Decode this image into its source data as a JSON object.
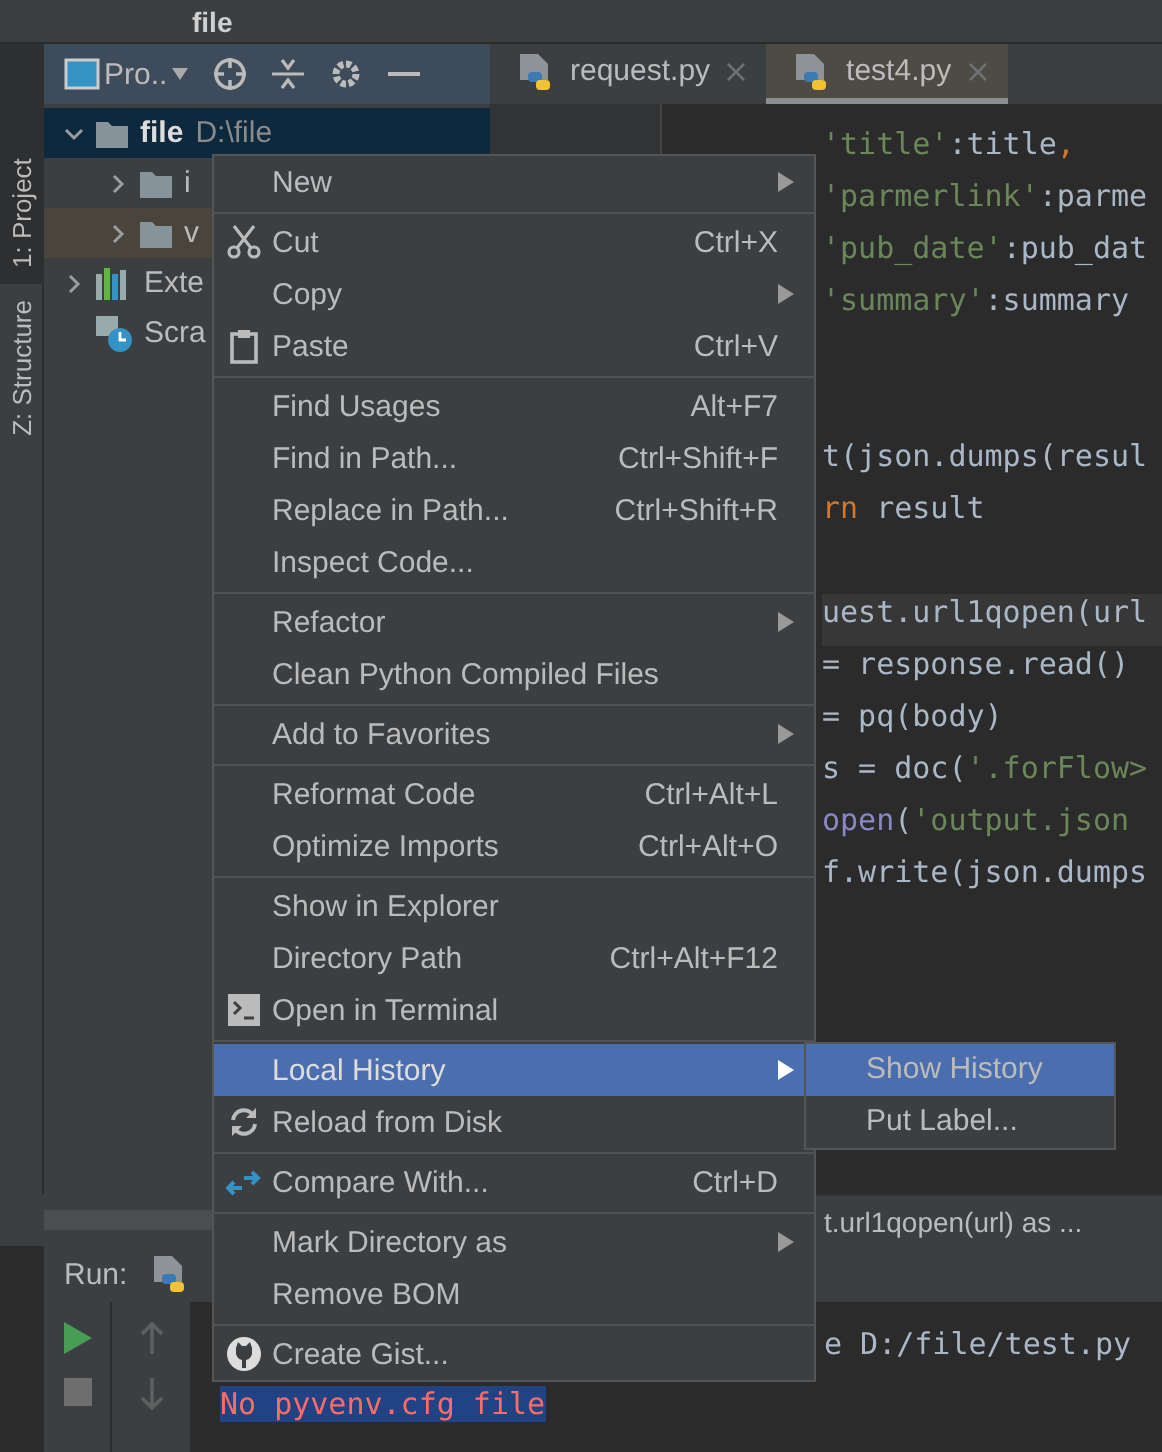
{
  "window": {
    "title": "file"
  },
  "tool_strip": [
    {
      "label": "1: Project",
      "selected": true
    },
    {
      "label": "Z: Structure",
      "selected": false
    }
  ],
  "project_panel": {
    "view": "Pro.."
  },
  "tree": [
    {
      "name": "file",
      "path": "D:\\file",
      "kind": "folder",
      "selected": true,
      "expanded": true,
      "children": [
        {
          "name": "i",
          "kind": "folder",
          "selected": false,
          "expanded": false
        },
        {
          "name": "v",
          "kind": "folder",
          "selected": true,
          "expanded": false
        }
      ]
    },
    {
      "name": "Exte",
      "kind": "library",
      "selected": false,
      "expanded": false
    },
    {
      "name": "Scra",
      "kind": "scratch",
      "selected": false
    }
  ],
  "tabs": [
    {
      "label": "request.py",
      "selected": false
    },
    {
      "label": "test4.py",
      "selected": true
    }
  ],
  "code_lines": [
    {
      "kind": "code",
      "current": false,
      "segments": [
        {
          "kind": "string",
          "text": "'title'"
        },
        {
          "kind": "plain",
          "text": ":title"
        },
        {
          "kind": "keyword",
          "text": ","
        }
      ]
    },
    {
      "kind": "code",
      "current": false,
      "segments": [
        {
          "kind": "string",
          "text": "'parmerlink'"
        },
        {
          "kind": "plain",
          "text": ":parme"
        }
      ]
    },
    {
      "kind": "code",
      "current": false,
      "segments": [
        {
          "kind": "string",
          "text": "'pub_date'"
        },
        {
          "kind": "plain",
          "text": ":pub_dat"
        }
      ]
    },
    {
      "kind": "code",
      "current": false,
      "segments": [
        {
          "kind": "string",
          "text": "'summary'"
        },
        {
          "kind": "plain",
          "text": ":summary"
        }
      ]
    },
    {
      "kind": "blank"
    },
    {
      "kind": "blank"
    },
    {
      "kind": "code",
      "current": false,
      "segments": [
        {
          "kind": "plain",
          "text": "t(json.dumps(resul"
        }
      ]
    },
    {
      "kind": "code",
      "current": false,
      "segments": [
        {
          "kind": "keyword",
          "text": "rn"
        },
        {
          "kind": "plain",
          "text": " result"
        }
      ]
    },
    {
      "kind": "blank"
    },
    {
      "kind": "code",
      "current": true,
      "segments": [
        {
          "kind": "plain",
          "text": "uest.url1qopen(url"
        }
      ]
    },
    {
      "kind": "code",
      "current": false,
      "segments": [
        {
          "kind": "plain",
          "text": "= response.read()"
        }
      ]
    },
    {
      "kind": "code",
      "current": false,
      "segments": [
        {
          "kind": "plain",
          "text": "= pq(body)"
        }
      ]
    },
    {
      "kind": "code",
      "current": false,
      "segments": [
        {
          "kind": "plain",
          "text": "s = doc("
        },
        {
          "kind": "string",
          "text": "'.forFlow>"
        }
      ]
    },
    {
      "kind": "code",
      "current": false,
      "segments": [
        {
          "kind": "builtin",
          "text": "open"
        },
        {
          "kind": "plain",
          "text": "("
        },
        {
          "kind": "string",
          "text": "'output.json"
        }
      ]
    },
    {
      "kind": "code",
      "current": false,
      "segments": [
        {
          "kind": "plain",
          "text": "f.write(json.dumps"
        }
      ]
    }
  ],
  "breadcrumb": "t.url1qopen(url) as ...",
  "run_panel": {
    "label": "Run:",
    "output": [
      {
        "kind": "plain",
        "text": "e D:/file/test.py"
      },
      {
        "kind": "error",
        "text": "No pyvenv.cfg file"
      }
    ]
  },
  "context_menu": [
    {
      "kind": "plain",
      "label": "New",
      "submenu": true,
      "selected": false
    },
    {
      "kind": "separator"
    },
    {
      "kind": "scissors",
      "label": "Cut",
      "shortcut": "Ctrl+X",
      "selected": false
    },
    {
      "kind": "plain",
      "label": "Copy",
      "submenu": true,
      "selected": false
    },
    {
      "kind": "clipboard",
      "label": "Paste",
      "shortcut": "Ctrl+V",
      "selected": false
    },
    {
      "kind": "separator"
    },
    {
      "kind": "plain",
      "label": "Find Usages",
      "shortcut": "Alt+F7",
      "selected": false
    },
    {
      "kind": "plain",
      "label": "Find in Path...",
      "shortcut": "Ctrl+Shift+F",
      "selected": false
    },
    {
      "kind": "plain",
      "label": "Replace in Path...",
      "shortcut": "Ctrl+Shift+R",
      "selected": false
    },
    {
      "kind": "plain",
      "label": "Inspect Code...",
      "selected": false
    },
    {
      "kind": "separator"
    },
    {
      "kind": "plain",
      "label": "Refactor",
      "submenu": true,
      "selected": false
    },
    {
      "kind": "plain",
      "label": "Clean Python Compiled Files",
      "selected": false
    },
    {
      "kind": "separator"
    },
    {
      "kind": "plain",
      "label": "Add to Favorites",
      "submenu": true,
      "selected": false
    },
    {
      "kind": "separator"
    },
    {
      "kind": "plain",
      "label": "Reformat Code",
      "shortcut": "Ctrl+Alt+L",
      "selected": false
    },
    {
      "kind": "plain",
      "label": "Optimize Imports",
      "shortcut": "Ctrl+Alt+O",
      "selected": false
    },
    {
      "kind": "separator"
    },
    {
      "kind": "plain",
      "label": "Show in Explorer",
      "selected": false
    },
    {
      "kind": "plain",
      "label": "Directory Path",
      "shortcut": "Ctrl+Alt+F12",
      "selected": false
    },
    {
      "kind": "terminal",
      "label": "Open in Terminal",
      "selected": false
    },
    {
      "kind": "separator"
    },
    {
      "kind": "plain",
      "label": "Local History",
      "submenu": true,
      "selected": true
    },
    {
      "kind": "reload",
      "label": "Reload from Disk",
      "selected": false
    },
    {
      "kind": "separator"
    },
    {
      "kind": "compare",
      "label": "Compare With...",
      "shortcut": "Ctrl+D",
      "selected": false
    },
    {
      "kind": "separator"
    },
    {
      "kind": "plain",
      "label": "Mark Directory as",
      "submenu": true,
      "selected": false
    },
    {
      "kind": "plain",
      "label": "Remove BOM",
      "selected": false
    },
    {
      "kind": "separator"
    },
    {
      "kind": "github",
      "label": "Create Gist...",
      "selected": false
    }
  ],
  "submenu": [
    {
      "label": "Show History",
      "selected": true
    },
    {
      "label": "Put Label...",
      "selected": false
    }
  ]
}
